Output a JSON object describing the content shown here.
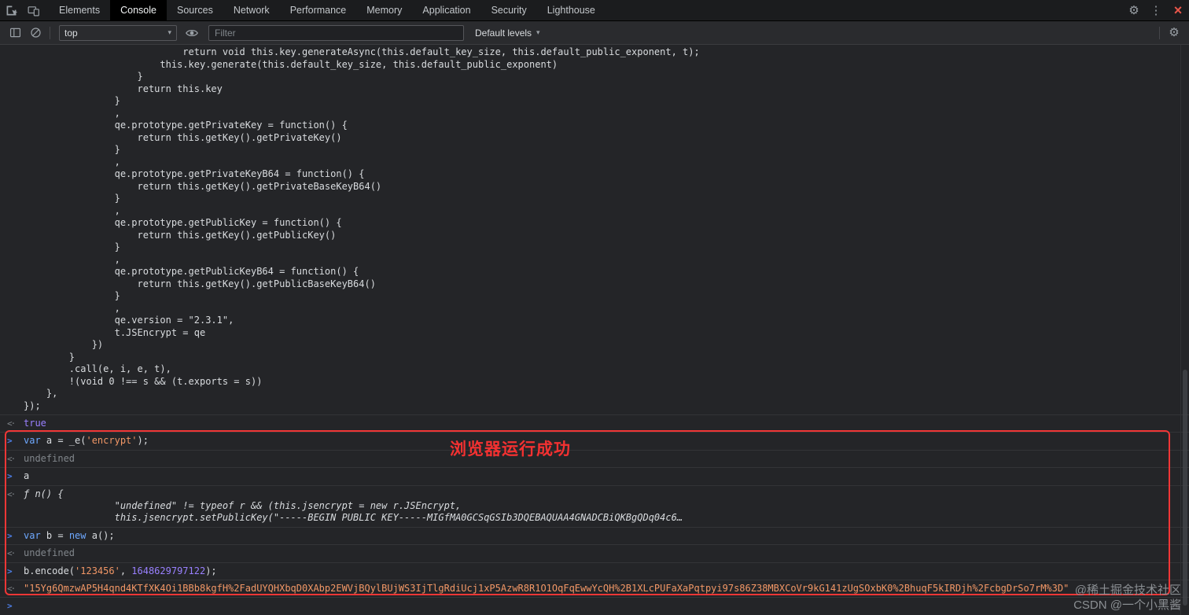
{
  "window": {
    "tabs": [
      "Elements",
      "Console",
      "Sources",
      "Network",
      "Performance",
      "Memory",
      "Application",
      "Security",
      "Lighthouse"
    ],
    "selected_tab": "Console"
  },
  "toolbar": {
    "context_selector": "top",
    "filter_placeholder": "Filter",
    "levels_label": "Default levels"
  },
  "icons": {
    "gear": "⚙",
    "more": "⋮",
    "close": "×",
    "caret_down": "▾",
    "input_prompt": ">",
    "output_arrow": "<·"
  },
  "console": {
    "code_lines": [
      "                            return void this.key.generateAsync(this.default_key_size, this.default_public_exponent, t);",
      "                        this.key.generate(this.default_key_size, this.default_public_exponent)",
      "                    }",
      "                    return this.key",
      "                }",
      "                ,",
      "                qe.prototype.getPrivateKey = function() {",
      "                    return this.getKey().getPrivateKey()",
      "                }",
      "                ,",
      "                qe.prototype.getPrivateKeyB64 = function() {",
      "                    return this.getKey().getPrivateBaseKeyB64()",
      "                }",
      "                ,",
      "                qe.prototype.getPublicKey = function() {",
      "                    return this.getKey().getPublicKey()",
      "                }",
      "                ,",
      "                qe.prototype.getPublicKeyB64 = function() {",
      "                    return this.getKey().getPublicBaseKeyB64()",
      "                }",
      "                ,",
      "                qe.version = \"2.3.1\",",
      "                t.JSEncrypt = qe",
      "            })",
      "        }",
      "        .call(e, i, e, t),",
      "        !(void 0 !== s && (t.exports = s))",
      "    },",
      "});"
    ],
    "messages": [
      {
        "type": "result",
        "segments": [
          {
            "t": "true",
            "c": "boolean"
          }
        ]
      },
      {
        "type": "input",
        "segments": [
          {
            "t": "var ",
            "c": "keyword"
          },
          {
            "t": "a = _e("
          },
          {
            "t": "'encrypt'",
            "c": "string"
          },
          {
            "t": ");"
          }
        ]
      },
      {
        "type": "result",
        "segments": [
          {
            "t": "undefined",
            "c": "muted"
          }
        ]
      },
      {
        "type": "input",
        "segments": [
          {
            "t": "a"
          }
        ]
      },
      {
        "type": "result",
        "lines": [
          "ƒ n() {",
          "                \"undefined\" != typeof r && (this.jsencrypt = new r.JSEncrypt,",
          "                this.jsencrypt.setPublicKey(\"-----BEGIN PUBLIC KEY-----MIGfMA0GCSqGSIb3DQEBAQUAA4GNADCBiQKBgQDq04c6…"
        ]
      },
      {
        "type": "input",
        "segments": [
          {
            "t": "var ",
            "c": "keyword"
          },
          {
            "t": "b = "
          },
          {
            "t": "new ",
            "c": "keyword"
          },
          {
            "t": "a();"
          }
        ]
      },
      {
        "type": "result",
        "segments": [
          {
            "t": "undefined",
            "c": "muted"
          }
        ]
      },
      {
        "type": "input",
        "segments": [
          {
            "t": "b.encode("
          },
          {
            "t": "'123456'",
            "c": "string"
          },
          {
            "t": ", "
          },
          {
            "t": "1648629797122",
            "c": "number"
          },
          {
            "t": ");"
          }
        ]
      },
      {
        "type": "result",
        "segments": [
          {
            "t": "\"15Yg6QmzwAP5H4qnd4KTfXK4Oi1BBb8kgfH%2FadUYQHXbqD0XAbp2EWVjBQylBUjWS3IjTlgRdiUcj1xP5AzwR8R1O1OqFqEwwYcQH%2B1XLcPUFaXaPqtpyi97s86Z38MBXCoVr9kG141zUgSOxbK0%2BhuqF5kIRDjh%2FcbgDrSo7rM%3D\"",
            "c": "string"
          }
        ]
      }
    ]
  },
  "annotation": {
    "text": "浏览器运行成功",
    "color": "#f43131",
    "box_color": "#f03636"
  },
  "watermark": {
    "line1": "@稀土掘金技术社区",
    "line2": "CSDN @一个小黑酱"
  }
}
